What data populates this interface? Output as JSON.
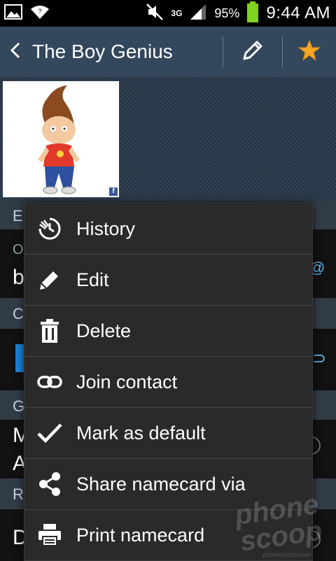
{
  "status_bar": {
    "network": "3G",
    "battery_percent": "95%",
    "time": "9:44 AM"
  },
  "action_bar": {
    "title": "The Boy Genius",
    "edit_icon": "pencil-icon",
    "favorite_icon": "star-icon",
    "star_color": "#f5a623"
  },
  "background_fragments": {
    "row1_head": "E",
    "row2_sub": "O",
    "row2_main": "b",
    "row3_head": "C",
    "row4_head": "G",
    "row5_line1": "M",
    "row5_line2": "A",
    "row6_head": "R",
    "row7_main": "D"
  },
  "menu": {
    "items": [
      {
        "label": "History",
        "icon": "history-icon"
      },
      {
        "label": "Edit",
        "icon": "pencil-icon"
      },
      {
        "label": "Delete",
        "icon": "trash-icon"
      },
      {
        "label": "Join contact",
        "icon": "link-icon"
      },
      {
        "label": "Mark as default",
        "icon": "checkmark-icon"
      },
      {
        "label": "Share namecard via",
        "icon": "share-icon"
      },
      {
        "label": "Print namecard",
        "icon": "printer-icon"
      }
    ]
  },
  "watermark": {
    "line1": "phone",
    "line2": "scoop",
    "url": "phonescoop.com"
  }
}
